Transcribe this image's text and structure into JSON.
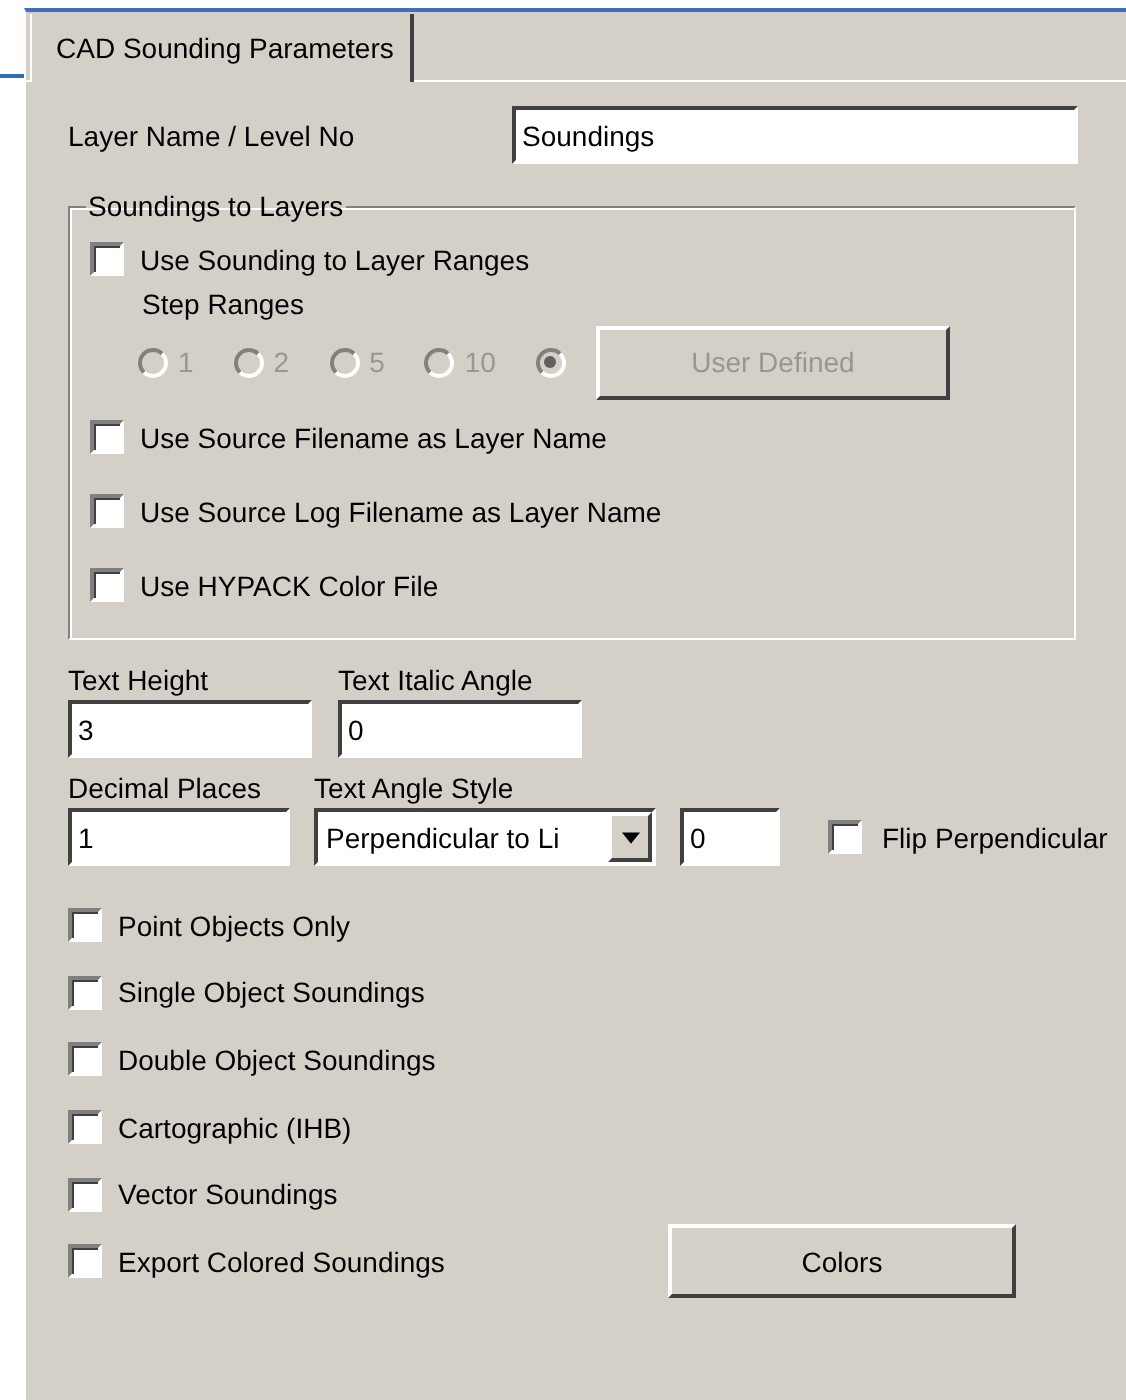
{
  "tabs": [
    {
      "label": "CAD Sounding Parameters",
      "selected": true
    }
  ],
  "layer_name": {
    "label": "Layer Name / Level No",
    "value": "Soundings"
  },
  "soundings_to_layers": {
    "title": "Soundings to Layers",
    "use_ranges": {
      "label": "Use Sounding to Layer Ranges",
      "checked": false
    },
    "step_ranges": {
      "label": "Step Ranges",
      "disabled": true,
      "options": [
        {
          "label": "1",
          "selected": false
        },
        {
          "label": "2",
          "selected": false
        },
        {
          "label": "5",
          "selected": false
        },
        {
          "label": "10",
          "selected": false
        },
        {
          "selected": true
        }
      ],
      "button": {
        "label": "User Defined",
        "disabled": true
      }
    },
    "options": [
      {
        "label": "Use Source Filename as Layer Name",
        "checked": false
      },
      {
        "label": "Use Source Log Filename as Layer Name",
        "checked": false
      },
      {
        "label": "Use HYPACK Color File",
        "checked": false
      }
    ]
  },
  "text_height": {
    "label": "Text Height",
    "value": "3"
  },
  "text_italic_angle": {
    "label": "Text Italic Angle",
    "value": "0"
  },
  "decimal_places": {
    "label": "Decimal Places",
    "value": "1"
  },
  "text_angle_style": {
    "label": "Text Angle Style",
    "value": "Perpendicular to Li",
    "angle": "0"
  },
  "flip_perpendicular": {
    "label": "Flip Perpendicular",
    "checked": false
  },
  "options": [
    {
      "label": "Point Objects Only",
      "checked": false
    },
    {
      "label": "Single Object Soundings",
      "checked": false
    },
    {
      "label": "Double Object Soundings",
      "checked": false
    },
    {
      "label": "Cartographic (IHB)",
      "checked": false
    },
    {
      "label": "Vector Soundings",
      "checked": false
    },
    {
      "label": "Export Colored Soundings",
      "checked": false
    }
  ],
  "colors_button": {
    "label": "Colors"
  }
}
